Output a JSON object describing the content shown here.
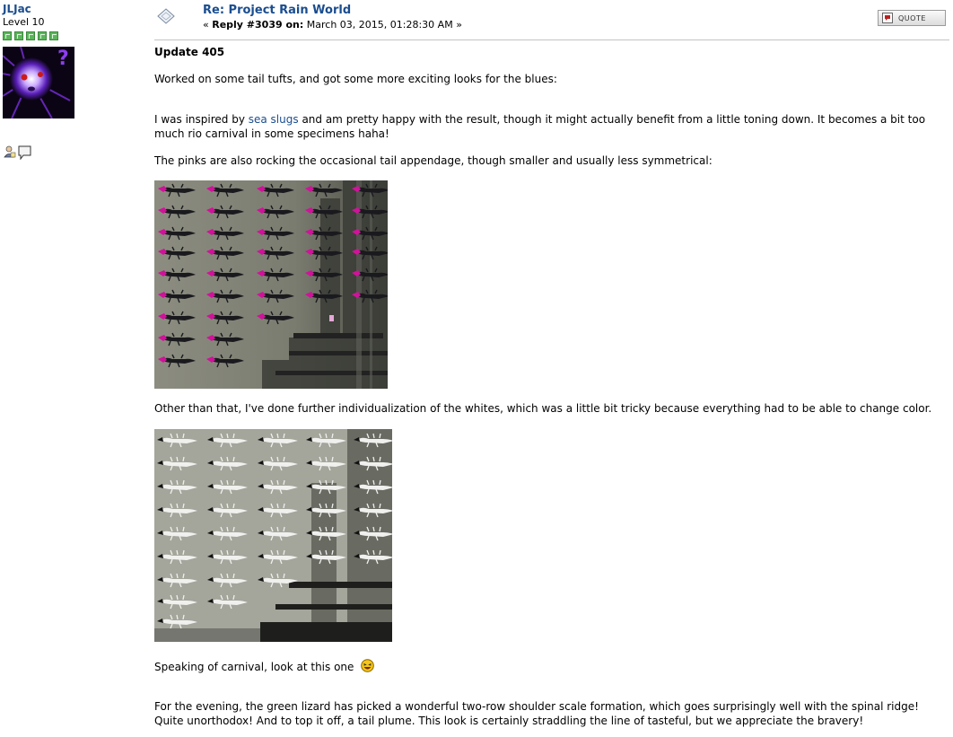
{
  "poster": {
    "name": "JLJac",
    "rank": "Level 10",
    "stars": 5,
    "icons": [
      "profile-icon",
      "personal-message-icon"
    ]
  },
  "post": {
    "title": "Re: Project Rain World",
    "meta_prefix": "«",
    "reply_label": "Reply #3039 on:",
    "date": "March 03, 2015, 01:28:30 AM",
    "meta_suffix": "»",
    "quote_label": "QUOTE"
  },
  "body": {
    "heading": "Update 405",
    "p1": "Worked on some tail tufts, and got some more exciting looks for the blues:",
    "p2_before": "I was inspired by ",
    "p2_link": "sea slugs",
    "p2_after": " and am pretty happy with the result, though it might actually benefit from a little toning down. It becomes a bit too much rio carnival in some specimens haha!",
    "p3": "The pinks are also rocking the occasional tail appendage, though smaller and usually less symmetrical:",
    "p4": "Other than that, I've done further individualization of the whites, which was a little bit tricky because everything had to be able to change color.",
    "p5": "Speaking of carnival, look at this one",
    "p6": "For the evening, the green lizard has picked a wonderful two-row shoulder scale formation, which goes surprisingly well with the spinal ridge! Quite unorthodox! And to top it off, a tail plume. This look is certainly straddling the line of tasteful, but we appreciate the bravery!"
  },
  "colors": {
    "link": "#1a4d8f",
    "star_green": "#5bb55b",
    "pink": "#d6149a",
    "white_lizard": "#f2f2f2"
  }
}
